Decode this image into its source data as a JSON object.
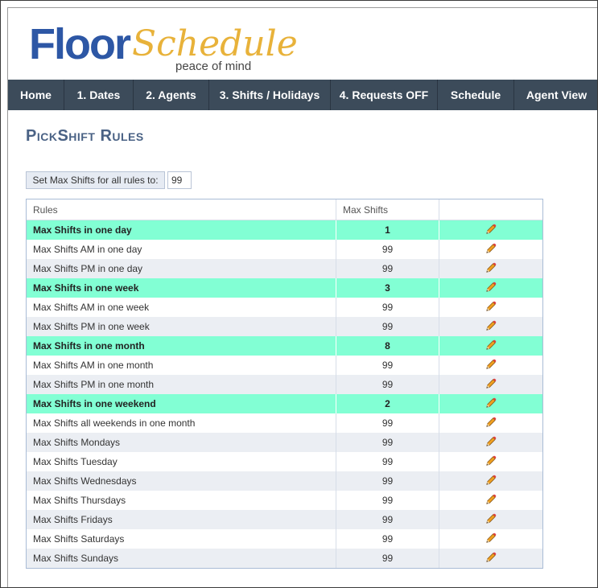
{
  "logo": {
    "floor": "Floor",
    "schedule": "Schedule",
    "tagline": "peace of mind"
  },
  "nav": [
    {
      "label": "Home",
      "w": 70
    },
    {
      "label": "1.  Dates",
      "w": 86
    },
    {
      "label": "2.  Agents",
      "w": 94
    },
    {
      "label": "3.  Shifts / Holidays",
      "w": 151
    },
    {
      "label": "4.  Requests OFF",
      "w": 133
    },
    {
      "label": "Schedule",
      "w": 95
    },
    {
      "label": "Agent View",
      "w": 106
    }
  ],
  "page": {
    "title": "PickShift Rules"
  },
  "set_max": {
    "button_label": "Set Max Shifts for all rules to:",
    "value": "99"
  },
  "table": {
    "headers": {
      "rules": "Rules",
      "max_shifts": "Max Shifts",
      "edit": ""
    },
    "rows": [
      {
        "rule": "Max Shifts in one day",
        "max": "1",
        "highlight": true
      },
      {
        "rule": "Max Shifts AM in one day",
        "max": "99",
        "highlight": false
      },
      {
        "rule": "Max Shifts PM in one day",
        "max": "99",
        "highlight": false
      },
      {
        "rule": "Max Shifts in one week",
        "max": "3",
        "highlight": true
      },
      {
        "rule": "Max Shifts AM in one week",
        "max": "99",
        "highlight": false
      },
      {
        "rule": "Max Shifts PM in one week",
        "max": "99",
        "highlight": false
      },
      {
        "rule": "Max Shifts in one month",
        "max": "8",
        "highlight": true
      },
      {
        "rule": "Max Shifts AM in one month",
        "max": "99",
        "highlight": false
      },
      {
        "rule": "Max Shifts PM in one month",
        "max": "99",
        "highlight": false
      },
      {
        "rule": "Max Shifts in one weekend",
        "max": "2",
        "highlight": true
      },
      {
        "rule": "Max Shifts all weekends in one month",
        "max": "99",
        "highlight": false
      },
      {
        "rule": "Max Shifts Mondays",
        "max": "99",
        "highlight": false
      },
      {
        "rule": "Max Shifts Tuesday",
        "max": "99",
        "highlight": false
      },
      {
        "rule": "Max Shifts Wednesdays",
        "max": "99",
        "highlight": false
      },
      {
        "rule": "Max Shifts Thursdays",
        "max": "99",
        "highlight": false
      },
      {
        "rule": "Max Shifts Fridays",
        "max": "99",
        "highlight": false
      },
      {
        "rule": "Max Shifts Saturdays",
        "max": "99",
        "highlight": false
      },
      {
        "rule": "Max Shifts Sundays",
        "max": "99",
        "highlight": false
      }
    ],
    "edit_icon": "pencil-icon"
  },
  "colors": {
    "brand_blue": "#2d57a5",
    "brand_gold": "#e8b23a",
    "nav_bg": "#3c4b5a",
    "highlight_row": "#82ffd4",
    "title": "#4a6285"
  }
}
